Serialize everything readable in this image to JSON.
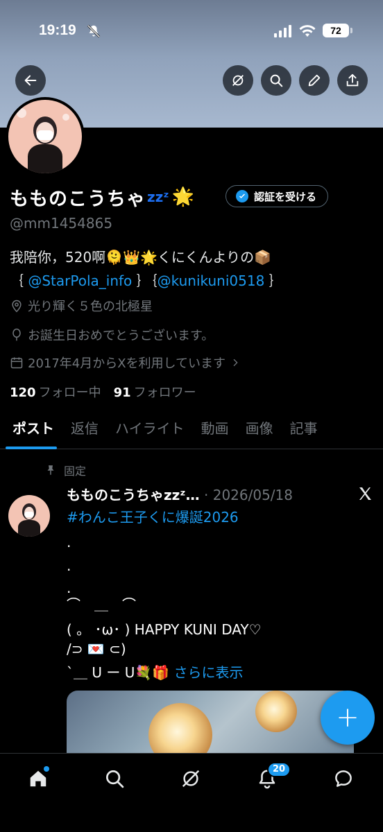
{
  "status_bar": {
    "time": "19:19",
    "battery": "72"
  },
  "header": {
    "back": "back-arrow-icon",
    "actions": [
      "grok-icon",
      "search-icon",
      "edit-icon",
      "share-icon"
    ]
  },
  "profile": {
    "name": "もものこうちゃ",
    "name_suffix": "zzᶻ",
    "verify_label": "認証を受ける",
    "handle": "@mm1454865",
    "bio_line1": "我陪你，520啊🫠👑🌟くにくんよりの📦",
    "bio_line2_prefix": "｛",
    "bio_link1": "@StarPola_info",
    "bio_line2_mid": "｝｛",
    "bio_link2": "@kunikuni0518",
    "bio_line2_suffix": "｝",
    "location": "光り輝く５色の北極星",
    "birthday": "お誕生日おめでとうございます。",
    "joined": "2017年4月からXを利用しています",
    "following_count": "120",
    "following_label": "フォロー中",
    "followers_count": "91",
    "followers_label": "フォロワー"
  },
  "tabs": [
    "ポスト",
    "返信",
    "ハイライト",
    "動画",
    "画像",
    "記事"
  ],
  "post": {
    "pinned_label": "固定",
    "author": "もものこうちゃzzᶻ…",
    "date": "· 2026/05/18",
    "hashtag": "#わんこ王子くに爆誕2026",
    "lines": [
      ".",
      ".",
      ".",
      "⌒　＿　⌒",
      "( 。 ･ω･ ) HAPPY KUNI DAY♡",
      "/⊃ 💌 ⊂)",
      "`＿ U ー U💐🎁 "
    ],
    "more": "さらに表示"
  },
  "fab_label": "+",
  "bottom_nav": {
    "items": [
      "home-icon",
      "search-icon",
      "grok-icon",
      "notifications-icon",
      "messages-icon"
    ],
    "notification_count": "20"
  }
}
